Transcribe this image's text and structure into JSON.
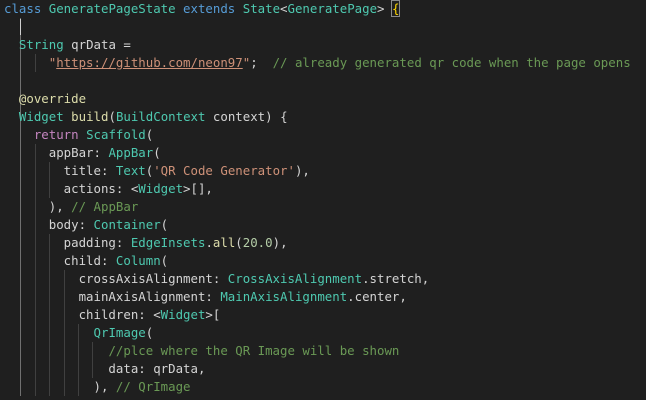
{
  "editor": {
    "language": "dart",
    "theme": "dark",
    "lines": [
      [
        [
          "class ",
          "kw"
        ],
        [
          "GeneratePageState",
          "cls"
        ],
        [
          " extends ",
          "kw"
        ],
        [
          "State",
          "cls"
        ],
        [
          "<",
          "pun"
        ],
        [
          "GeneratePage",
          "cls"
        ],
        [
          "> ",
          "pun"
        ],
        [
          "{",
          "brk"
        ]
      ],
      [],
      [
        [
          "  ",
          "pun"
        ],
        [
          "String",
          "cls"
        ],
        [
          " qrData = ",
          "pun"
        ]
      ],
      [
        [
          "      \"",
          "str"
        ],
        [
          "https://github.com/neon97",
          "url"
        ],
        [
          "\"",
          "str"
        ],
        [
          ";  ",
          "pun"
        ],
        [
          "// already generated qr code when the page opens",
          "cmt"
        ]
      ],
      [],
      [
        [
          "  ",
          "pun"
        ],
        [
          "@override",
          "fn"
        ]
      ],
      [
        [
          "  ",
          "pun"
        ],
        [
          "Widget",
          "cls"
        ],
        [
          " ",
          "pun"
        ],
        [
          "build",
          "fn"
        ],
        [
          "(",
          "pun"
        ],
        [
          "BuildContext",
          "cls"
        ],
        [
          " context) {",
          "pun"
        ]
      ],
      [
        [
          "    ",
          "pun"
        ],
        [
          "return",
          "ctrl"
        ],
        [
          " ",
          "pun"
        ],
        [
          "Scaffold",
          "cls"
        ],
        [
          "(",
          "pun"
        ]
      ],
      [
        [
          "      appBar: ",
          "pun"
        ],
        [
          "AppBar",
          "cls"
        ],
        [
          "(",
          "pun"
        ]
      ],
      [
        [
          "        title: ",
          "pun"
        ],
        [
          "Text",
          "cls"
        ],
        [
          "(",
          "pun"
        ],
        [
          "'QR Code Generator'",
          "str"
        ],
        [
          "),",
          "pun"
        ]
      ],
      [
        [
          "        actions: <",
          "pun"
        ],
        [
          "Widget",
          "cls"
        ],
        [
          ">[],",
          "pun"
        ]
      ],
      [
        [
          "      ), ",
          "pun"
        ],
        [
          "// AppBar",
          "cmt"
        ]
      ],
      [
        [
          "      body: ",
          "pun"
        ],
        [
          "Container",
          "cls"
        ],
        [
          "(",
          "pun"
        ]
      ],
      [
        [
          "        padding: ",
          "pun"
        ],
        [
          "EdgeInsets",
          "cls"
        ],
        [
          ".",
          "pun"
        ],
        [
          "all",
          "fn"
        ],
        [
          "(",
          "pun"
        ],
        [
          "20.0",
          "num"
        ],
        [
          "),",
          "pun"
        ]
      ],
      [
        [
          "        child: ",
          "pun"
        ],
        [
          "Column",
          "cls"
        ],
        [
          "(",
          "pun"
        ]
      ],
      [
        [
          "          crossAxisAlignment: ",
          "pun"
        ],
        [
          "CrossAxisAlignment",
          "cls"
        ],
        [
          ".stretch,",
          "pun"
        ]
      ],
      [
        [
          "          mainAxisAlignment: ",
          "pun"
        ],
        [
          "MainAxisAlignment",
          "cls"
        ],
        [
          ".center,",
          "pun"
        ]
      ],
      [
        [
          "          children: <",
          "pun"
        ],
        [
          "Widget",
          "cls"
        ],
        [
          ">[",
          "pun"
        ]
      ],
      [
        [
          "            ",
          "pun"
        ],
        [
          "QrImage",
          "cls"
        ],
        [
          "(",
          "pun"
        ]
      ],
      [
        [
          "              ",
          "pun"
        ],
        [
          "//plce where the QR Image will be shown",
          "cmt"
        ]
      ],
      [
        [
          "              data: qrData,",
          "pun"
        ]
      ],
      [
        [
          "            ), ",
          "pun"
        ],
        [
          "// QrImage",
          "cmt"
        ]
      ]
    ]
  }
}
